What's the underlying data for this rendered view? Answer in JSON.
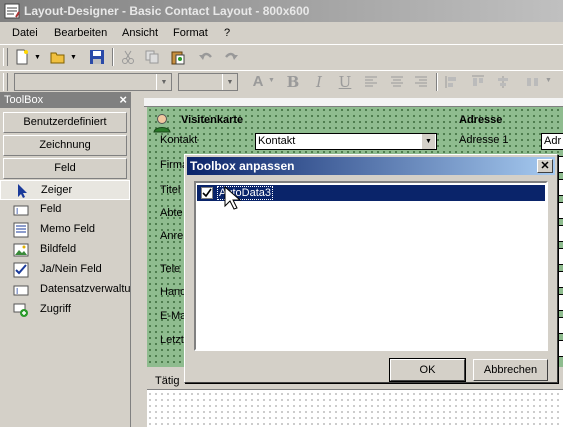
{
  "window": {
    "title": "Layout-Designer - Basic Contact Layout - 800x600"
  },
  "menu": {
    "items": [
      "Datei",
      "Bearbeiten",
      "Ansicht",
      "Format",
      "?"
    ]
  },
  "toolbox": {
    "title": "ToolBox",
    "close_glyph": "×",
    "groups": [
      "Benutzerdefiniert",
      "Zeichnung",
      "Feld"
    ],
    "items": [
      {
        "label": "Zeiger",
        "icon": "pointer-icon"
      },
      {
        "label": "Feld",
        "icon": "field-icon"
      },
      {
        "label": "Memo Feld",
        "icon": "memo-field-icon"
      },
      {
        "label": "Bildfeld",
        "icon": "image-field-icon"
      },
      {
        "label": "Ja/Nein Feld",
        "icon": "checkbox-field-icon"
      },
      {
        "label": "Datensatzverwaltu",
        "icon": "record-manager-icon"
      },
      {
        "label": "Zugriff",
        "icon": "access-icon"
      }
    ]
  },
  "layout": {
    "section1_title": "Visitenkarte",
    "section2_title": "Adresse",
    "left_labels": [
      "Kontakt",
      "Firma",
      "Titel",
      "Abte",
      "Anre",
      "Tele",
      "Hand",
      "E-Ma",
      "Letzt"
    ],
    "kontakt_value": "Kontakt",
    "right_label": "Adresse 1",
    "right_value": "Adr",
    "tab_label": "Tätig"
  },
  "dialog": {
    "title": "Toolbox anpassen",
    "close_glyph": "✕",
    "list_item": "AutoData3",
    "list_item_checked": true,
    "ok_label": "OK",
    "cancel_label": "Abbrechen"
  },
  "colors": {
    "dialog_title": "#0a246a",
    "selection": "#0a246a",
    "layout_green": "#8fbc8f"
  }
}
